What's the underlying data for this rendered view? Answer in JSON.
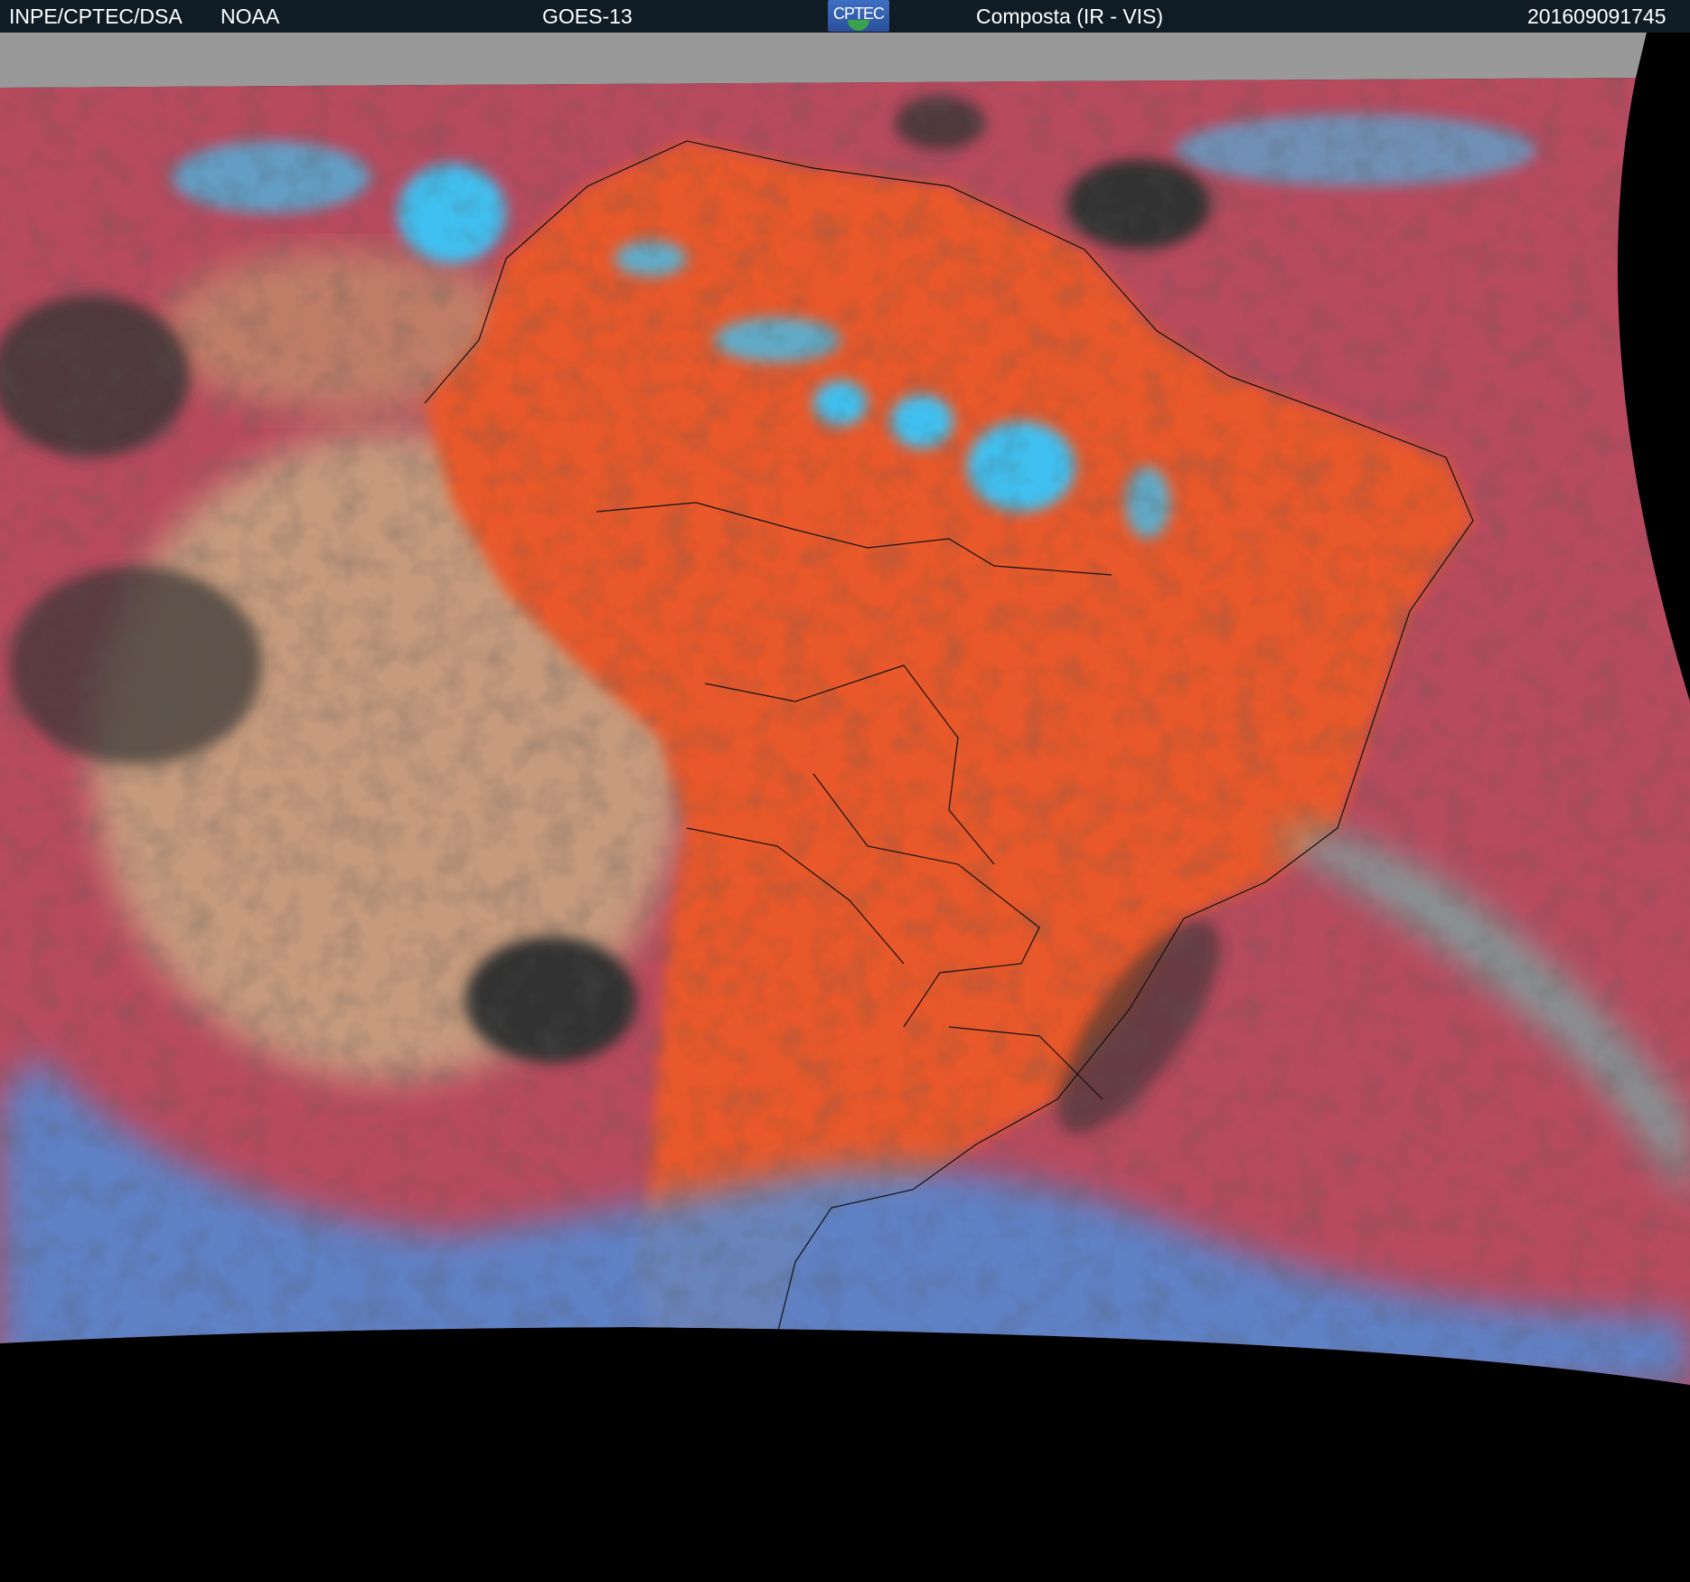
{
  "header": {
    "agency": "INPE/CPTEC/DSA",
    "partner": "NOAA",
    "satellite": "GOES-13",
    "logo_text": "CPTEC",
    "product": "Composta (IR - VIS)",
    "timestamp": "201609091745"
  },
  "colors": {
    "header_bg": "#0f1c26",
    "ocean": "#b84a5e",
    "land": "#e8582a",
    "cloud_high": "#3fc0f0",
    "cloud_low": "#c9b27a",
    "no_data": "#999999",
    "space": "#000000"
  }
}
